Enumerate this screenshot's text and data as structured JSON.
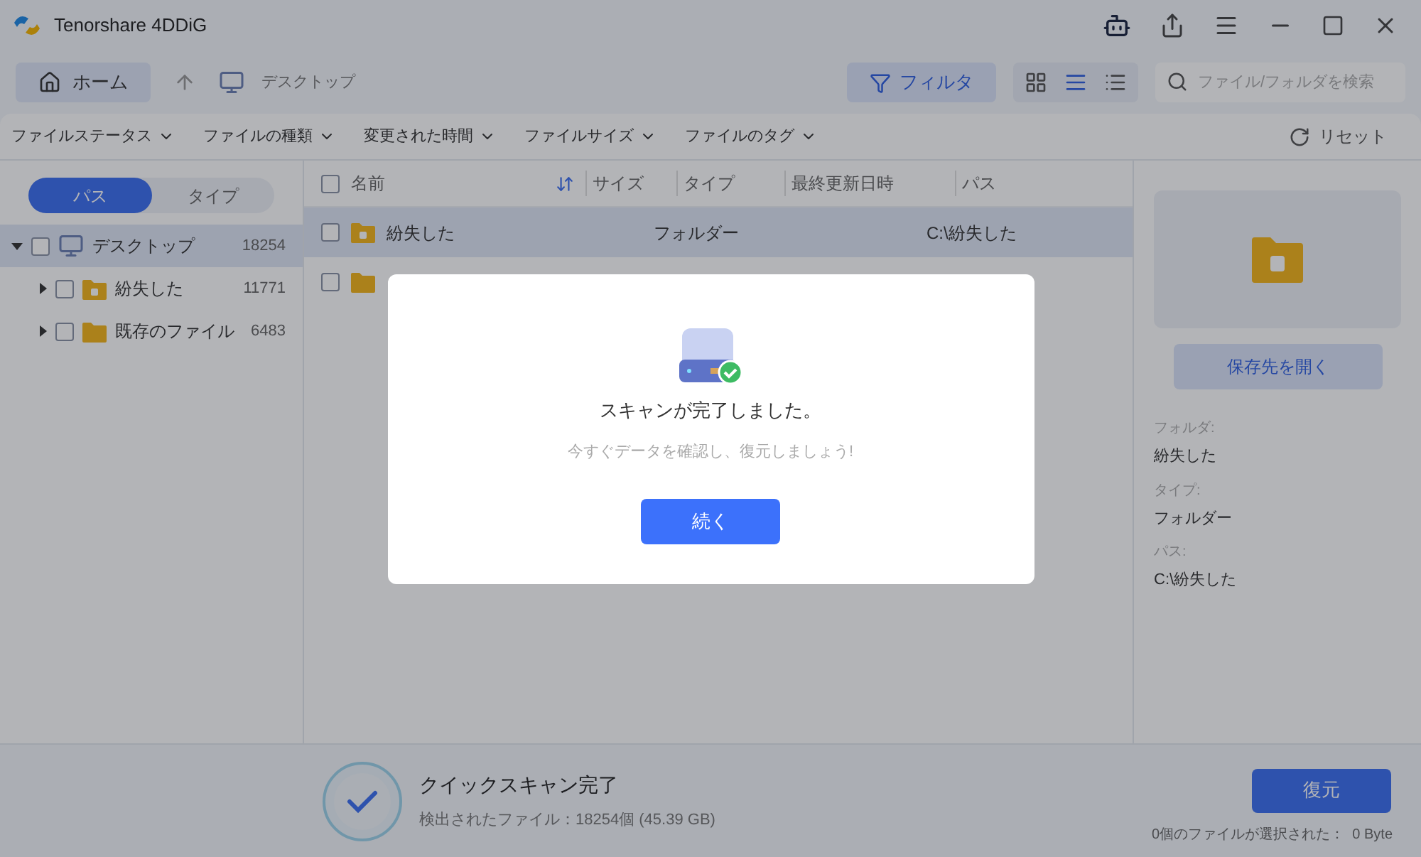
{
  "window": {
    "title": "Tenorshare 4DDiG"
  },
  "toolbar": {
    "home": "ホーム",
    "breadcrumb": "デスクトップ",
    "filter": {
      "label": "フィルタ",
      "selected": true
    },
    "views": [
      {
        "kind": "grid",
        "selected": false
      },
      {
        "kind": "detail",
        "selected": true
      },
      {
        "kind": "list",
        "selected": false
      }
    ],
    "search": {
      "placeholder": "ファイル/フォルダを検索"
    }
  },
  "filters": [
    "ファイルステータス",
    "ファイルの種類",
    "変更された時間",
    "ファイルサイズ",
    "ファイルのタグ"
  ],
  "reset": "リセット",
  "sidebar": {
    "tabs": [
      {
        "label": "パス",
        "selected": true
      },
      {
        "label": "タイプ",
        "selected": false
      }
    ],
    "tree": [
      {
        "label": "デスクトップ",
        "count": "18254",
        "kind": "desktop",
        "expanded": true,
        "selected": true,
        "checked": false,
        "children": [
          {
            "label": "紛失した",
            "count": "11771",
            "kind": "lost",
            "expanded": false,
            "selected": false,
            "checked": false
          },
          {
            "label": "既存のファイル",
            "count": "6483",
            "kind": "folder",
            "expanded": false,
            "selected": false,
            "checked": false
          }
        ]
      }
    ]
  },
  "table": {
    "select_all": {
      "checked": false
    },
    "columns": [
      "名前",
      "サイズ",
      "タイプ",
      "最終更新日時",
      "パス"
    ],
    "rows": [
      {
        "name": "紛失した",
        "type": "フォルダー",
        "path": "C:\\紛失した",
        "kind": "lost",
        "selected": true,
        "checked": false
      },
      {
        "kind": "folder",
        "selected": false,
        "checked": false
      }
    ]
  },
  "details": {
    "open_button": "保存先を開く",
    "fields": [
      {
        "label": "フォルダ:",
        "value": "紛失した"
      },
      {
        "label": "タイプ:",
        "value": "フォルダー"
      },
      {
        "label": "パス:",
        "value": "C:\\紛失した"
      }
    ]
  },
  "status": {
    "title": "クイックスキャン完了",
    "found": "検出されたファイル：18254個 (45.39 GB)",
    "recover_button": "復元",
    "selection": "0個のファイルが選択された：  0 Byte"
  },
  "dialog": {
    "title": "スキャンが完了しました。",
    "message": "今すぐデータを確認し、復元しましょう!",
    "button": "続く"
  }
}
